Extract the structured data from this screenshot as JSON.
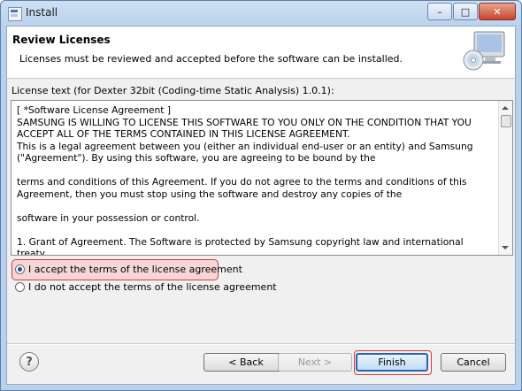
{
  "window": {
    "title": "Install",
    "controls": {
      "minimize": "–",
      "maximize": "□",
      "close": "✕"
    }
  },
  "header": {
    "title": "Review Licenses",
    "description": "Licenses must be reviewed and accepted before the software can be installed.",
    "art_icon": "computer-cd-icon"
  },
  "license": {
    "label": "License text (for Dexter 32bit (Coding-time Static Analysis) 1.0.1):",
    "text": "[ *Software License Agreement ]\n   SAMSUNG IS WILLING TO LICENSE THIS SOFTWARE TO YOU ONLY ON THE CONDITION THAT YOU ACCEPT ALL OF THE TERMS CONTAINED IN THIS LICENSE AGREEMENT.\n   This is a legal agreement between you (either an individual end-user or an entity) and Samsung (\"Agreement\").  By using this software, you are agreeing to be bound by the\n\nterms and conditions of this Agreement.  If you do not agree to the terms and conditions of this Agreement, then you must stop using the software and destroy any copies of the\n\nsoftware in your possession or control.\n\n1.    Grant of Agreement.  The Software is protected by Samsung copyright law and international treaty."
  },
  "options": {
    "accept": "I accept the terms of the license agreement",
    "decline": "I do not accept the terms of the license agreement",
    "selected": "accept"
  },
  "buttons": {
    "help": "?",
    "back": "< Back",
    "next": "Next >",
    "finish": "Finish",
    "cancel": "Cancel"
  },
  "colors": {
    "highlight_border": "#d23b3b",
    "highlight_fill": "#f6d6d6",
    "default_button_border": "#2a62b6"
  }
}
